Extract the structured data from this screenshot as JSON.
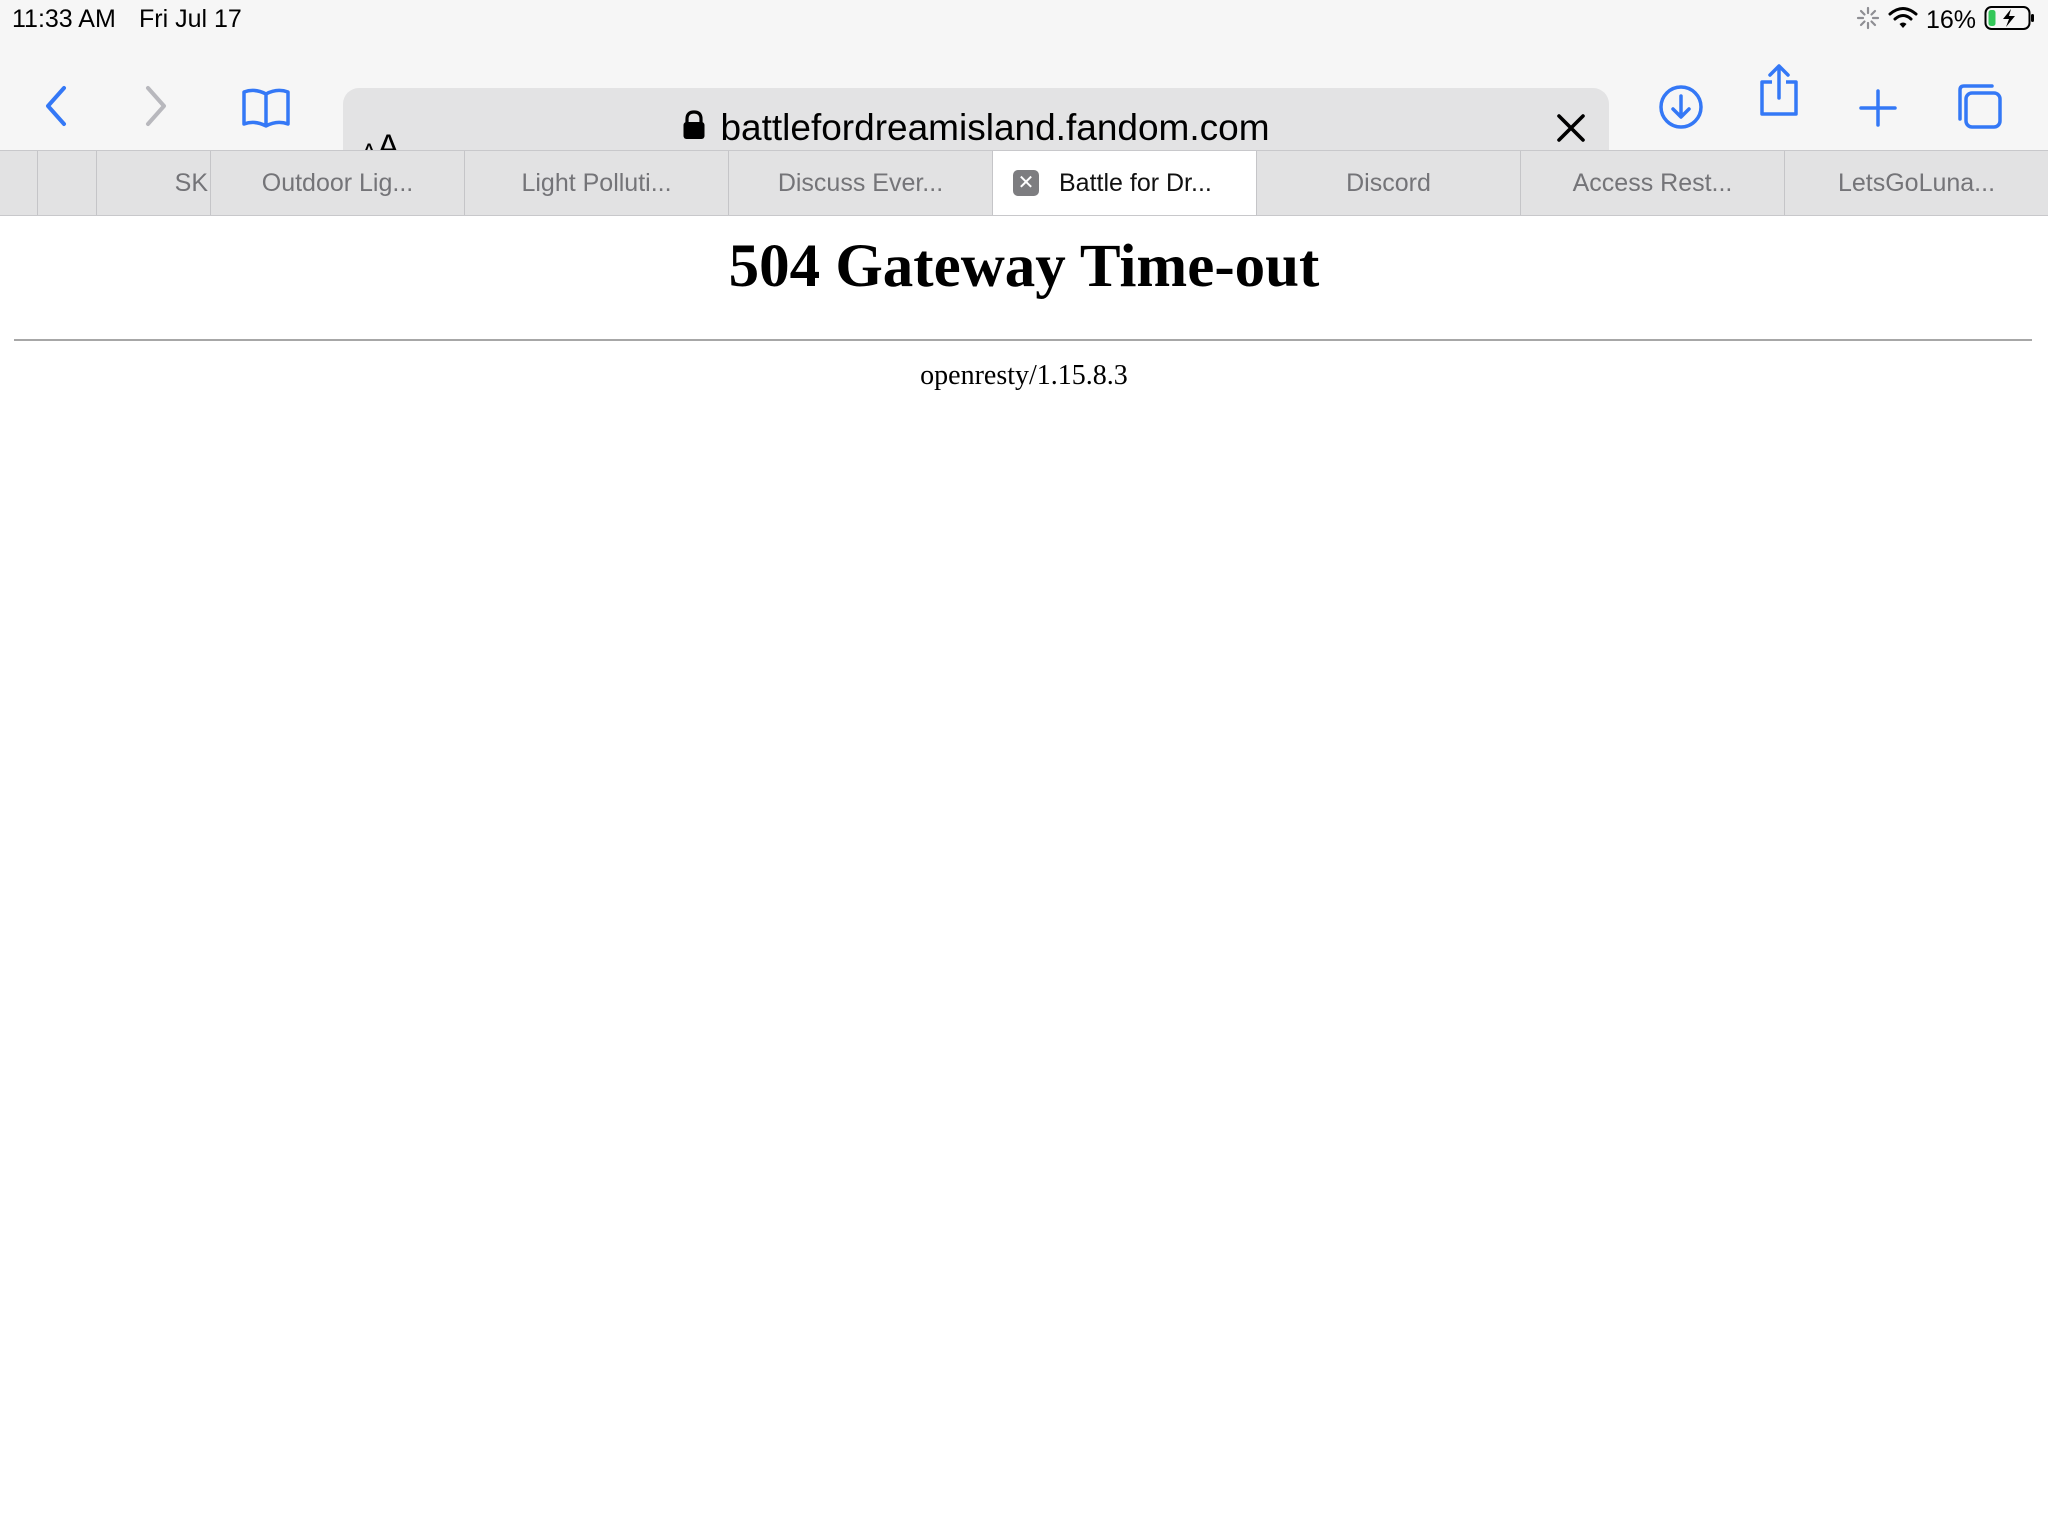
{
  "status_bar": {
    "time": "11:33 AM",
    "date": "Fri Jul 17",
    "battery_percent": "16%",
    "icons": [
      "activity-spinner-icon",
      "wifi-icon",
      "battery-charging-icon"
    ]
  },
  "toolbar": {
    "reader_label_small": "A",
    "reader_label_large": "A",
    "url": "battlefordreamisland.fandom.com",
    "load_progress": 0.12,
    "icons": [
      "back-icon",
      "forward-icon",
      "bookmarks-icon",
      "lock-icon",
      "clear-icon",
      "downloads-icon",
      "share-icon",
      "new-tab-icon",
      "tabs-overview-icon"
    ]
  },
  "tabs": [
    {
      "title": ""
    },
    {
      "title": ""
    },
    {
      "title": "SK"
    },
    {
      "title": "Outdoor Lig..."
    },
    {
      "title": "Light Polluti..."
    },
    {
      "title": "Discuss Ever..."
    },
    {
      "title": "Battle for Dr...",
      "active": true
    },
    {
      "title": "Discord"
    },
    {
      "title": "Access Rest..."
    },
    {
      "title": "LetsGoLuna..."
    }
  ],
  "page": {
    "heading": "504 Gateway Time-out",
    "server": "openresty/1.15.8.3"
  },
  "colors": {
    "accent": "#3478f6",
    "toolbar_bg": "#f6f6f6",
    "tab_strip_bg": "#e2e2e3"
  }
}
